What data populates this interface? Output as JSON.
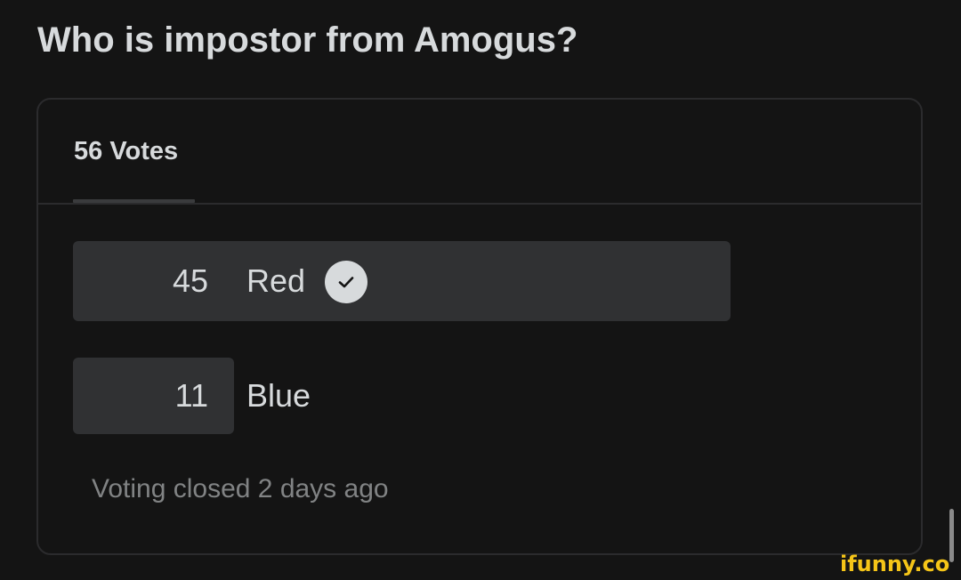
{
  "post": {
    "title": "Who is impostor from Amogus?"
  },
  "poll": {
    "votes_label": "56 Votes",
    "options": [
      {
        "count": "45",
        "label": "Red",
        "fraction": 0.8036,
        "selected": true,
        "icon": "check-circle-icon"
      },
      {
        "count": "11",
        "label": "Blue",
        "fraction": 0.1964,
        "selected": false
      }
    ],
    "status": "Voting closed 2 days ago"
  },
  "watermark": {
    "text": "ifunny.co",
    "color": "#f5c518"
  },
  "colors": {
    "background": "#141414",
    "bar": "#303133",
    "text": "#d7dadc",
    "muted": "#818384"
  }
}
